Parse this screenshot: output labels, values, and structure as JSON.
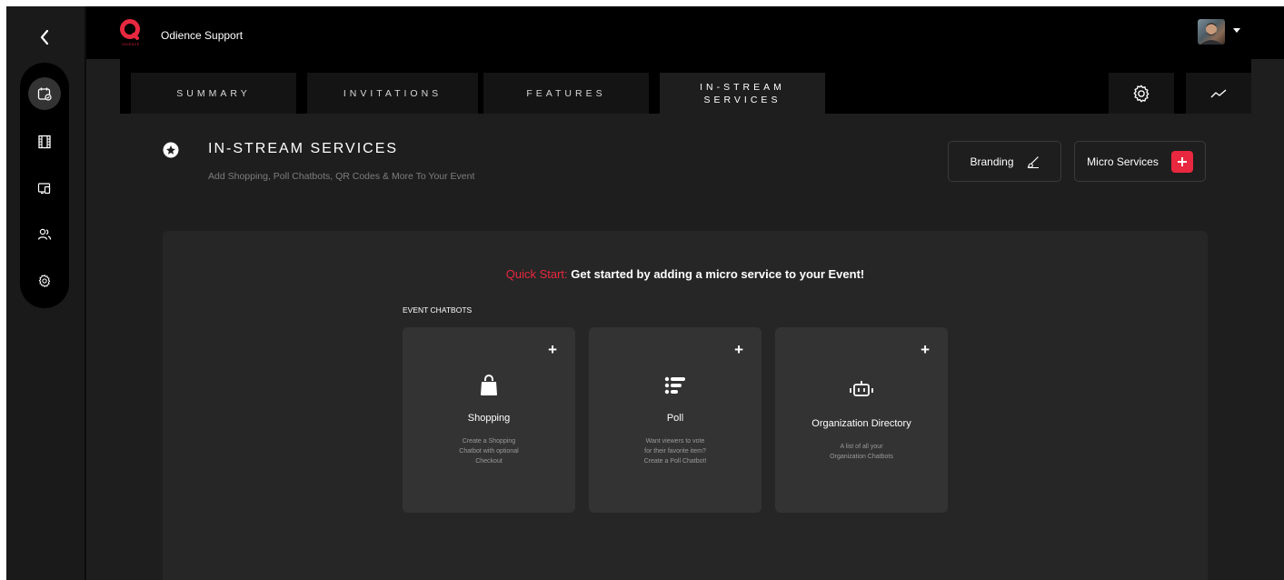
{
  "topbar": {
    "org_name": "Odience Support",
    "logo_text": "ODIENCE"
  },
  "rail": {
    "items": [
      {
        "icon": "calendar-check-icon",
        "active": true
      },
      {
        "icon": "film-icon",
        "active": false
      },
      {
        "icon": "devices-icon",
        "active": false
      },
      {
        "icon": "users-icon",
        "active": false
      },
      {
        "icon": "gear-icon",
        "active": false
      }
    ]
  },
  "tabs": [
    {
      "label": "SUMMARY",
      "active": false
    },
    {
      "label": "INVITATIONS",
      "active": false
    },
    {
      "label": "FEATURES",
      "active": false
    },
    {
      "label_line1": "IN-STREAM",
      "label_line2": "SERVICES",
      "active": true
    }
  ],
  "header": {
    "title": "IN-STREAM SERVICES",
    "subtitle": "Add Shopping, Poll Chatbots, QR Codes & More To Your Event",
    "branding_label": "Branding",
    "micro_services_label": "Micro Services"
  },
  "panel": {
    "quick_start_label": "Quick Start:",
    "quick_start_text": "Get started by adding a micro service to your Event!",
    "category_label": "EVENT CHATBOTS",
    "cards": [
      {
        "title": "Shopping",
        "desc_lines": [
          "Create a Shopping",
          "Chatbot with optional",
          "Checkout"
        ],
        "icon": "shopping-bag-icon"
      },
      {
        "title": "Poll",
        "desc_lines": [
          "Want viewers to vote",
          "for their favorite item?",
          "Create a Poll Chatbot!"
        ],
        "icon": "list-icon"
      },
      {
        "title": "Organization Directory",
        "desc_lines": [
          "A list of all your",
          "Organization Chatbots"
        ],
        "icon": "robot-icon"
      }
    ]
  },
  "colors": {
    "accent": "#e8283f",
    "background": "#1e1e1e",
    "card": "#333333"
  }
}
